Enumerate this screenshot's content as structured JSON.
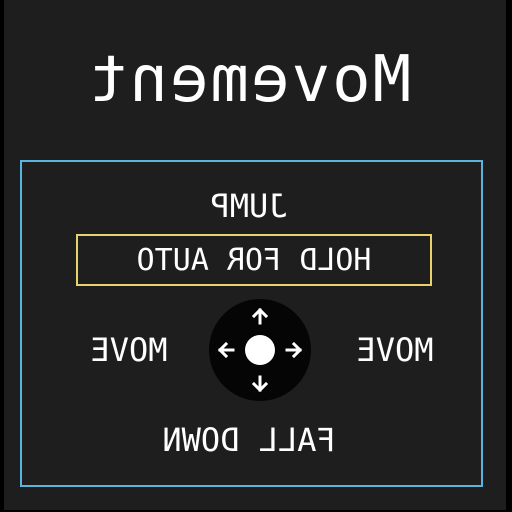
{
  "screen": {
    "title": "Movement",
    "controls": {
      "jump_label": "JUMP",
      "hold_label": "HOLD FOR AUTO",
      "move_left_label": "MOVE",
      "move_right_label": "MOVE",
      "fall_label": "FALL DOWN",
      "stick_icon": "joystick-icon"
    }
  },
  "colors": {
    "background": "#1e1e1e",
    "panel_border": "#5ab4e0",
    "hold_border": "#e8d36a",
    "text": "#ffffff",
    "stick": "#050505"
  }
}
